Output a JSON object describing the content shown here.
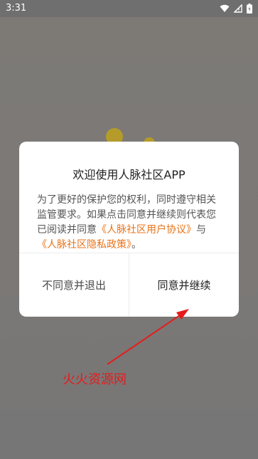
{
  "status_bar": {
    "time": "3:31",
    "icons": [
      "wifi-icon",
      "signal-icon",
      "battery-icon"
    ]
  },
  "dialog": {
    "title": "欢迎使用人脉社区APP",
    "body_text_1": "为了更好的保护您的权利，同时遵守相关监管要求。如果点击同意并继续则代表您已阅读并同意",
    "link_user_agreement": "《人脉社区用户协议》",
    "body_text_2": "与",
    "link_privacy_policy": "《人脉社区隐私政策》",
    "body_text_3": "。",
    "decline_label": "不同意并退出",
    "accept_label": "同意并继续"
  },
  "watermark": "火火资源网",
  "colors": {
    "link": "#e8731a",
    "annotation": "#e51c1c",
    "overlay": "#7b7b7b"
  }
}
